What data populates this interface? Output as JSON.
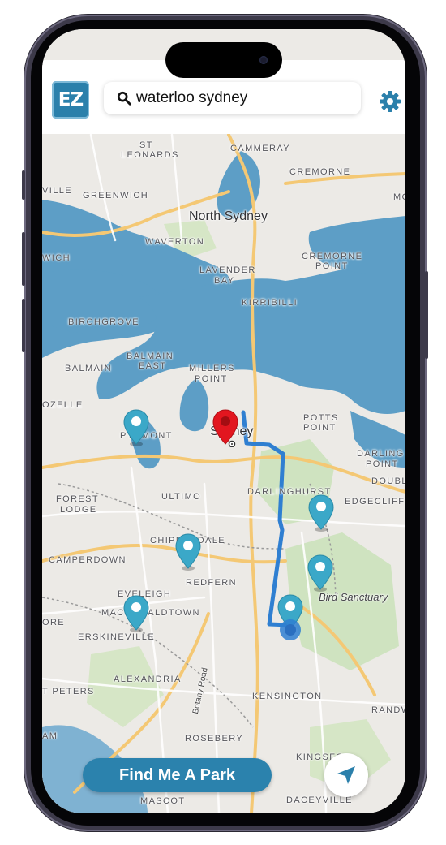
{
  "app": {
    "logo_text": "EZ",
    "brand_color": "#2b80ab"
  },
  "search": {
    "value": "waterloo sydney",
    "icon": "search-icon"
  },
  "settings": {
    "icon": "gear-icon"
  },
  "map": {
    "water_color": "#5d9ec6",
    "route_color": "#2f7fd1",
    "suburbs": {
      "st_leonards_1": "ST",
      "st_leonards_2": "LEONARDS",
      "cammeray": "CAMMERAY",
      "cremorne": "CREMORNE",
      "ville": "VILLE",
      "greenwich": "GREENWICH",
      "mo": "MO",
      "north_sydney": "North Sydney",
      "waverton": "WAVERTON",
      "wich": "WICH",
      "cremorne_point_1": "CREMORNE",
      "cremorne_point_2": "POINT",
      "lavender_bay_1": "LAVENDER",
      "lavender_bay_2": "BAY",
      "kirribilli": "KIRRIBILLI",
      "birchgrove": "BIRCHGROVE",
      "balmain_east_1": "BALMAIN",
      "balmain_east_2": "EAST",
      "balmain": "BALMAIN",
      "millers_point_1": "MILLERS",
      "millers_point_2": "POINT",
      "ozelle": "OZELLE",
      "potts_point_1": "POTTS",
      "potts_point_2": "POINT",
      "pyrmont": "PYRMONT",
      "sydney": "Sydney",
      "darling_point_1": "DARLING",
      "darling_point_2": "POINT",
      "doubl": "DOUBL",
      "darlinghurst": "DARLINGHURST",
      "edgecliff": "EDGECLIFF",
      "forest_lodge_1": "FOREST",
      "forest_lodge_2": "LODGE",
      "ultimo": "ULTIMO",
      "chippendale": "CHIPPENDALE",
      "camperdown": "CAMPERDOWN",
      "redfern": "REDFERN",
      "bird_sanctuary": "Bird Sanctuary",
      "eveleigh": "EVELEIGH",
      "macdonaldtown": "MACDONALDTOWN",
      "ore": "ORE",
      "erskineville": "ERSKINEVILLE",
      "alexandria": "ALEXANDRIA",
      "botany_road": "Botany Road",
      "t_peters": "T PETERS",
      "kensington": "KENSINGTON",
      "randw": "RANDW",
      "am": "AM",
      "rosebery": "ROSEBERY",
      "kingsford": "KINGSFO",
      "mascot": "MASCOT",
      "daceyville": "DACEYVILLE"
    }
  },
  "actions": {
    "find_park_label": "Find Me A Park",
    "locate_icon": "navigation-arrow-icon"
  }
}
